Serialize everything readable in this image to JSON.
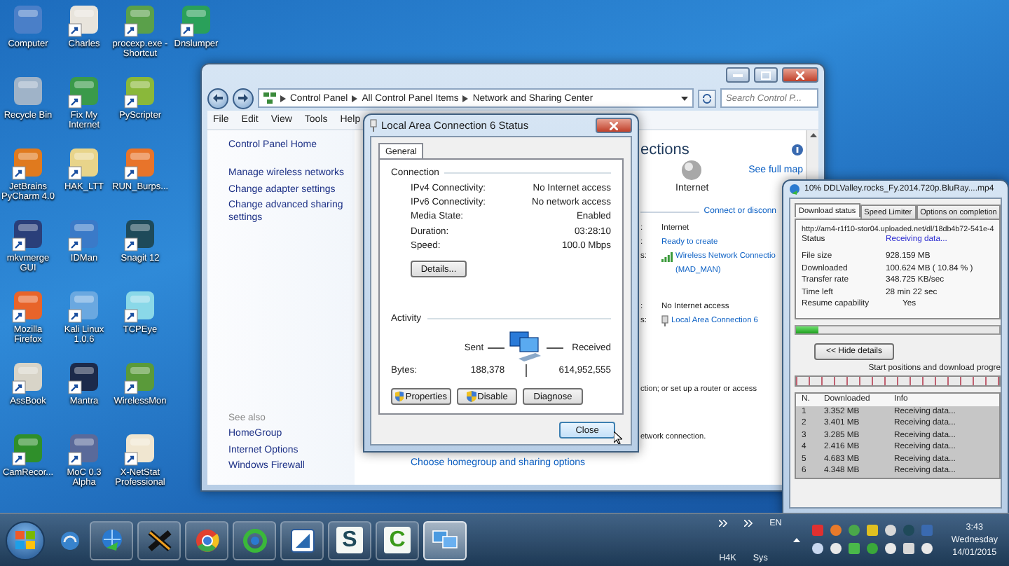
{
  "desktop_icons": [
    {
      "label": "Computer",
      "shortcut": false,
      "color": "#4a7fc8"
    },
    {
      "label": "Recycle Bin",
      "shortcut": false,
      "color": "#9fb3c8"
    },
    {
      "label": "JetBrains PyCharm 4.0",
      "shortcut": true,
      "color": "#e07a1e"
    },
    {
      "label": "mkvmerge GUI",
      "shortcut": true,
      "color": "#2a3f7a"
    },
    {
      "label": "Mozilla Firefox",
      "shortcut": true,
      "color": "#e8642a"
    },
    {
      "label": "AssBook",
      "shortcut": true,
      "color": "#d8d4c8"
    },
    {
      "label": "CamRecor...",
      "shortcut": true,
      "color": "#2f8f2a"
    },
    {
      "label": "Charles",
      "shortcut": true,
      "color": "#e8e4dc"
    },
    {
      "label": "Fix My Internet",
      "shortcut": true,
      "color": "#3a9a4a"
    },
    {
      "label": "HAK_LTT",
      "shortcut": true,
      "color": "#e8d48a"
    },
    {
      "label": "IDMan",
      "shortcut": true,
      "color": "#3a7ac8"
    },
    {
      "label": "Kali Linux 1.0.6",
      "shortcut": true,
      "color": "#6aa8e0"
    },
    {
      "label": "Mantra",
      "shortcut": true,
      "color": "#1c2a4a"
    },
    {
      "label": "MoC 0.3 Alpha",
      "shortcut": true,
      "color": "#5a6a9a"
    },
    {
      "label": "procexp.exe - Shortcut",
      "shortcut": true,
      "color": "#5aa04a"
    },
    {
      "label": "PyScripter",
      "shortcut": true,
      "color": "#8ab83a"
    },
    {
      "label": "RUN_Burps...",
      "shortcut": true,
      "color": "#e8742a"
    },
    {
      "label": "Snagit 12",
      "shortcut": true,
      "color": "#1e4a5a"
    },
    {
      "label": "TCPEye",
      "shortcut": true,
      "color": "#8ad8e8"
    },
    {
      "label": "WirelessMon",
      "shortcut": true,
      "color": "#5a9a3a"
    },
    {
      "label": "X-NetStat Professional",
      "shortcut": true,
      "color": "#f0e6d0"
    },
    {
      "label": "Dnslumper",
      "shortcut": true,
      "color": "#2aa05a"
    }
  ],
  "control_panel": {
    "breadcrumb": [
      "Control Panel",
      "All Control Panel Items",
      "Network and Sharing Center"
    ],
    "search": {
      "placeholder": "Search Control P..."
    },
    "menu": [
      "File",
      "Edit",
      "View",
      "Tools",
      "Help"
    ],
    "sidebar": {
      "home": "Control Panel Home",
      "tasks": [
        "Manage wireless networks",
        "Change adapter settings",
        "Change advanced sharing settings"
      ],
      "see_also_heading": "See also",
      "see_also": [
        "HomeGroup",
        "Internet Options",
        "Windows Firewall"
      ]
    },
    "content": {
      "heading": "ections",
      "map_node": "Internet",
      "map_link": "See full map",
      "connect_link": "Connect or disconn",
      "networks": [
        {
          "rows": [
            {
              "key": ":",
              "value": "Internet",
              "link": false
            },
            {
              "key": ":",
              "value": "Ready to create",
              "link": true
            },
            {
              "key": "s:",
              "value": "Wireless Network Connectio",
              "value_2": "(MAD_MAN)",
              "link": true,
              "kind": "signal"
            }
          ]
        },
        {
          "rows": [
            {
              "key": ":",
              "value": "No Internet access",
              "link": false
            },
            {
              "key": "s:",
              "value": "Local Area Connection 6",
              "link": true,
              "kind": "plug"
            }
          ]
        }
      ],
      "lines": [
        "ction; or set up a router or access",
        "etwork connection."
      ],
      "footer_link": "Choose homegroup and sharing options"
    }
  },
  "status_dialog": {
    "title": "Local Area Connection 6 Status",
    "tabs": [
      {
        "label": "General",
        "selected": true
      }
    ],
    "connection_heading": "Connection",
    "connection": [
      {
        "label": "IPv4 Connectivity:",
        "value": "No Internet access"
      },
      {
        "label": "IPv6 Connectivity:",
        "value": "No network access"
      },
      {
        "label": "Media State:",
        "value": "Enabled"
      },
      {
        "label": "Duration:",
        "value": "03:28:10"
      },
      {
        "label": "Speed:",
        "value": "100.0 Mbps"
      }
    ],
    "details_button": "Details...",
    "activity_heading": "Activity",
    "sent_label": "Sent",
    "received_label": "Received",
    "bytes_label": "Bytes:",
    "bytes_sent": "188,378",
    "bytes_received": "614,952,555",
    "buttons": [
      {
        "label": "Properties",
        "shield": true
      },
      {
        "label": "Disable",
        "shield": true
      },
      {
        "label": "Diagnose",
        "shield": false
      }
    ],
    "close_button": "Close"
  },
  "download_window": {
    "title": "10% DDLValley.rocks_Fy.2014.720p.BluRay....mp4",
    "tabs": [
      {
        "label": "Download status",
        "selected": true
      },
      {
        "label": "Speed Limiter",
        "selected": false
      },
      {
        "label": "Options on completion",
        "selected": false
      }
    ],
    "url": "http://am4-r1f10-stor04.uploaded.net/dl/18db4b72-541e-4",
    "status": {
      "label": "Status",
      "value": "Receiving data..."
    },
    "details": [
      {
        "label": "File size",
        "value": "928.159  MB"
      },
      {
        "label": "Downloaded",
        "value": "100.624  MB  ( 10.84 % )"
      },
      {
        "label": "Transfer rate",
        "value": "348.725  KB/sec"
      },
      {
        "label": "Time left",
        "value": "28 min 22 sec"
      },
      {
        "label": "Resume capability",
        "value": "Yes"
      }
    ],
    "progress": {
      "level": 0.108
    },
    "hide_button": "<< Hide details",
    "segments_label": "Start positions and download progre",
    "table": {
      "columns": [
        "N.",
        "Downloaded",
        "Info"
      ],
      "rows": [
        [
          "1",
          "3.352  MB",
          "Receiving data..."
        ],
        [
          "2",
          "3.401  MB",
          "Receiving data..."
        ],
        [
          "3",
          "3.285  MB",
          "Receiving data..."
        ],
        [
          "4",
          "2.416  MB",
          "Receiving data..."
        ],
        [
          "5",
          "4.683  MB",
          "Receiving data..."
        ],
        [
          "6",
          "4.348  MB",
          "Receiving data..."
        ]
      ]
    }
  },
  "taskbar": {
    "pinned": [
      {
        "kind": "disc",
        "active": false
      },
      {
        "kind": "globe",
        "active": false
      },
      {
        "kind": "cross",
        "active": false
      },
      {
        "kind": "ring",
        "active": false
      },
      {
        "kind": "arrows",
        "active": false
      },
      {
        "kind": "pen",
        "active": false
      },
      {
        "kind": "letter",
        "glyph": "S",
        "color": "#1f4a5a",
        "active": false
      },
      {
        "kind": "letter",
        "glyph": "C",
        "color": "#3a9a1a",
        "active": false
      },
      {
        "kind": "monitor",
        "active": true
      }
    ],
    "language": "EN",
    "toolbars": [
      "H4K",
      "Sys"
    ],
    "clock": {
      "time": "3:43",
      "day": "Wednesday",
      "date": "14/01/2015"
    }
  }
}
